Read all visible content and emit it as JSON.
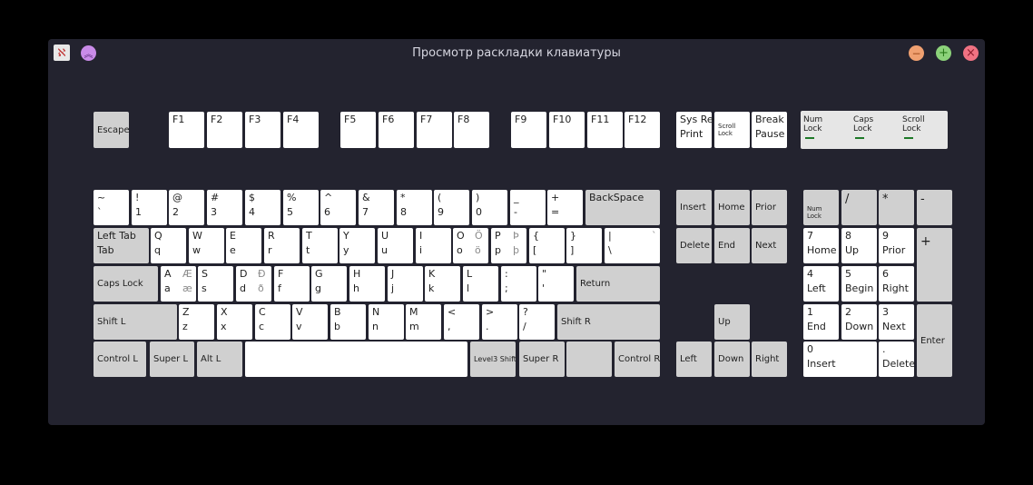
{
  "window": {
    "title": "Просмотр раскладки клавиатуры",
    "app_icon_glyph": "ℵ",
    "keep_above_glyph": "︽",
    "min_glyph": "−",
    "max_glyph": "+",
    "close_glyph": "×",
    "colors": {
      "background": "#23232f",
      "key_white": "#ffffff",
      "key_gray": "#d0d0d0",
      "led_on": "#1e7a28"
    }
  },
  "leds": {
    "num": "Num\nLock",
    "caps": "Caps\nLock",
    "scroll": "Scroll\nLock"
  },
  "keys": {
    "esc": "Escape",
    "f1": "F1",
    "f2": "F2",
    "f3": "F3",
    "f4": "F4",
    "f5": "F5",
    "f6": "F6",
    "f7": "F7",
    "f8": "F8",
    "f9": "F9",
    "f10": "F10",
    "f11": "F11",
    "f12": "F12",
    "sysreq": "Sys Req",
    "print": "Print",
    "scrolllock": "Scroll\nLock",
    "break": "Break",
    "pause": "Pause",
    "grave_t": "~",
    "grave_b": "`",
    "k1_t": "!",
    "k1_b": "1",
    "k2_t": "@",
    "k2_b": "2",
    "k3_t": "#",
    "k3_b": "3",
    "k4_t": "$",
    "k4_b": "4",
    "k5_t": "%",
    "k5_b": "5",
    "k6_t": "^",
    "k6_b": "6",
    "k7_t": "&",
    "k7_b": "7",
    "k8_t": "*",
    "k8_b": "8",
    "k9_t": "(",
    "k9_b": "9",
    "k0_t": ")",
    "k0_b": "0",
    "minus_t": "_",
    "minus_b": "-",
    "equal_t": "+",
    "equal_b": "=",
    "backspace": "BackSpace",
    "tab_t": "Left Tab",
    "tab_b": "Tab",
    "q_t": "Q",
    "q_b": "q",
    "w_t": "W",
    "w_b": "w",
    "e_t": "E",
    "e_b": "e",
    "r_t": "R",
    "r_b": "r",
    "tk_t": "T",
    "tk_b": "t",
    "y_t": "Y",
    "y_b": "y",
    "u_t": "U",
    "u_b": "u",
    "i_t": "I",
    "i_b": "i",
    "o_t": "O",
    "o_b": "o",
    "o_tr": "Ö",
    "o_br": "ö",
    "p_t": "P",
    "p_b": "p",
    "p_tr": "Þ",
    "p_br": "þ",
    "lbr_t": "{",
    "lbr_b": "[",
    "rbr_t": "}",
    "rbr_b": "]",
    "bsl_t": "|",
    "bsl_b": "\\",
    "bsl_tr": "`",
    "caps": "Caps Lock",
    "a_t": "A",
    "a_b": "a",
    "a_tr": "Æ",
    "a_br": "æ",
    "s_t": "S",
    "s_b": "s",
    "d_t": "D",
    "d_b": "d",
    "d_tr": "Ð",
    "d_br": "ð",
    "f_t": "F",
    "f_b": "f",
    "g_t": "G",
    "g_b": "g",
    "h_t": "H",
    "h_b": "h",
    "j_t": "J",
    "j_b": "j",
    "k_t": "K",
    "k_b": "k",
    "l_t": "L",
    "l_b": "l",
    "semi_t": ":",
    "semi_b": ";",
    "quote_t": "\"",
    "quote_b": "'",
    "return": "Return",
    "shift_l": "Shift L",
    "z_t": "Z",
    "z_b": "z",
    "x_t": "X",
    "x_b": "x",
    "ck_t": "C",
    "ck_b": "c",
    "v_t": "V",
    "v_b": "v",
    "bk_t": "B",
    "bk_b": "b",
    "n_t": "N",
    "n_b": "n",
    "m_t": "M",
    "m_b": "m",
    "comma_t": "<",
    "comma_b": ",",
    "period_t": ">",
    "period_b": ".",
    "slash_t": "?",
    "slash_b": "/",
    "shift_r": "Shift R",
    "ctrl_l": "Control L",
    "super_l": "Super L",
    "alt_l": "Alt L",
    "level3": "Level3 Shift",
    "super_r": "Super R",
    "ctrl_r": "Control R",
    "insert": "Insert",
    "home": "Home",
    "prior": "Prior",
    "delete": "Delete",
    "end": "End",
    "next": "Next",
    "up": "Up",
    "left": "Left",
    "down": "Down",
    "right": "Right",
    "np_num": "Num\nLock",
    "np_div": "/",
    "np_mul": "*",
    "np_sub": "-",
    "np_add": "+",
    "np7_t": "7",
    "np7_b": "Home",
    "np8_t": "8",
    "np8_b": "Up",
    "np9_t": "9",
    "np9_b": "Prior",
    "np4_t": "4",
    "np4_b": "Left",
    "np5_t": "5",
    "np5_b": "Begin",
    "np6_t": "6",
    "np6_b": "Right",
    "np1_t": "1",
    "np1_b": "End",
    "np2_t": "2",
    "np2_b": "Down",
    "np3_t": "3",
    "np3_b": "Next",
    "np0_t": "0",
    "np0_b": "Insert",
    "npdot_t": ".",
    "npdot_b": "Delete",
    "np_enter": "Enter"
  }
}
